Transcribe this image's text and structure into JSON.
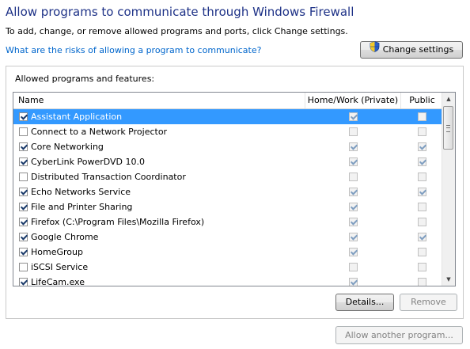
{
  "header": {
    "title": "Allow programs to communicate through Windows Firewall",
    "subtitle": "To add, change, or remove allowed programs and ports, click Change settings.",
    "risk_link": "What are the risks of allowing a program to communicate?",
    "change_settings_label": "Change settings",
    "change_settings_icon": "uac-shield-icon"
  },
  "group": {
    "label": "Allowed programs and features:",
    "columns": {
      "name": "Name",
      "home": "Home/Work (Private)",
      "public": "Public"
    },
    "rows": [
      {
        "name": "Assistant Application",
        "enabled": true,
        "home": true,
        "public": false,
        "selected": true
      },
      {
        "name": "Connect to a Network Projector",
        "enabled": false,
        "home": false,
        "public": false
      },
      {
        "name": "Core Networking",
        "enabled": true,
        "home": true,
        "public": true
      },
      {
        "name": "CyberLink PowerDVD 10.0",
        "enabled": true,
        "home": true,
        "public": true
      },
      {
        "name": "Distributed Transaction Coordinator",
        "enabled": false,
        "home": false,
        "public": false
      },
      {
        "name": "Echo Networks Service",
        "enabled": true,
        "home": true,
        "public": true
      },
      {
        "name": "File and Printer Sharing",
        "enabled": true,
        "home": true,
        "public": false
      },
      {
        "name": "Firefox (C:\\Program Files\\Mozilla Firefox)",
        "enabled": true,
        "home": true,
        "public": false
      },
      {
        "name": "Google Chrome",
        "enabled": true,
        "home": true,
        "public": true
      },
      {
        "name": "HomeGroup",
        "enabled": true,
        "home": true,
        "public": false
      },
      {
        "name": "iSCSI Service",
        "enabled": false,
        "home": false,
        "public": false
      },
      {
        "name": "LifeCam.exe",
        "enabled": true,
        "home": true,
        "public": false
      }
    ],
    "details_label": "Details...",
    "remove_label": "Remove"
  },
  "footer": {
    "allow_another_label": "Allow another program..."
  },
  "colors": {
    "title": "#1e3287",
    "link": "#0066cc",
    "selection": "#3399ff"
  }
}
